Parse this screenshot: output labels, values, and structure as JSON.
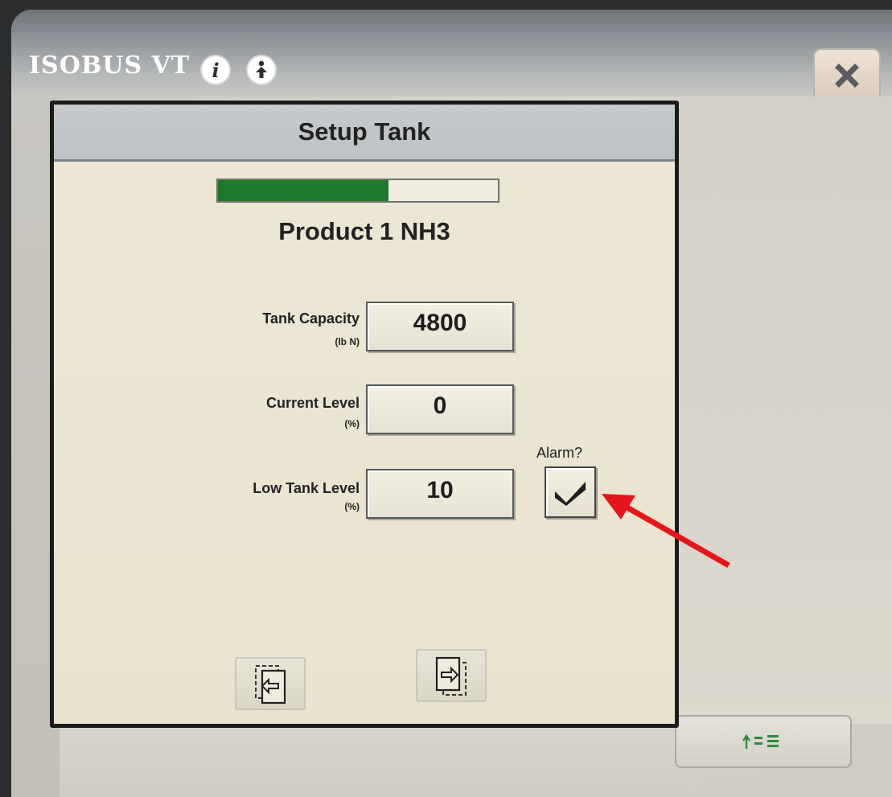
{
  "window": {
    "title": "ISOBUS VT",
    "info_icon": "info-icon",
    "upload_icon": "upload-icon",
    "close_icon": "close-icon"
  },
  "dialog": {
    "title": "Setup Tank",
    "progress_fraction": 0.61,
    "product_name": "Product 1 NH3",
    "fields": [
      {
        "label": "Tank Capacity",
        "unit": "(lb N)",
        "value": "4800"
      },
      {
        "label": "Current Level",
        "unit": "(%)",
        "value": "0"
      },
      {
        "label": "Low Tank Level",
        "unit": "(%)",
        "value": "10"
      }
    ],
    "alarm": {
      "label": "Alarm?",
      "checked": true
    },
    "nav": {
      "prev_icon": "page-back-icon",
      "next_icon": "page-forward-icon"
    }
  },
  "softkey": {
    "icon": "sort-list-icon"
  },
  "colors": {
    "progress_fill": "#1d7a2c",
    "annotation_arrow": "#e8141b",
    "close_icon": "#5a5c5e"
  }
}
